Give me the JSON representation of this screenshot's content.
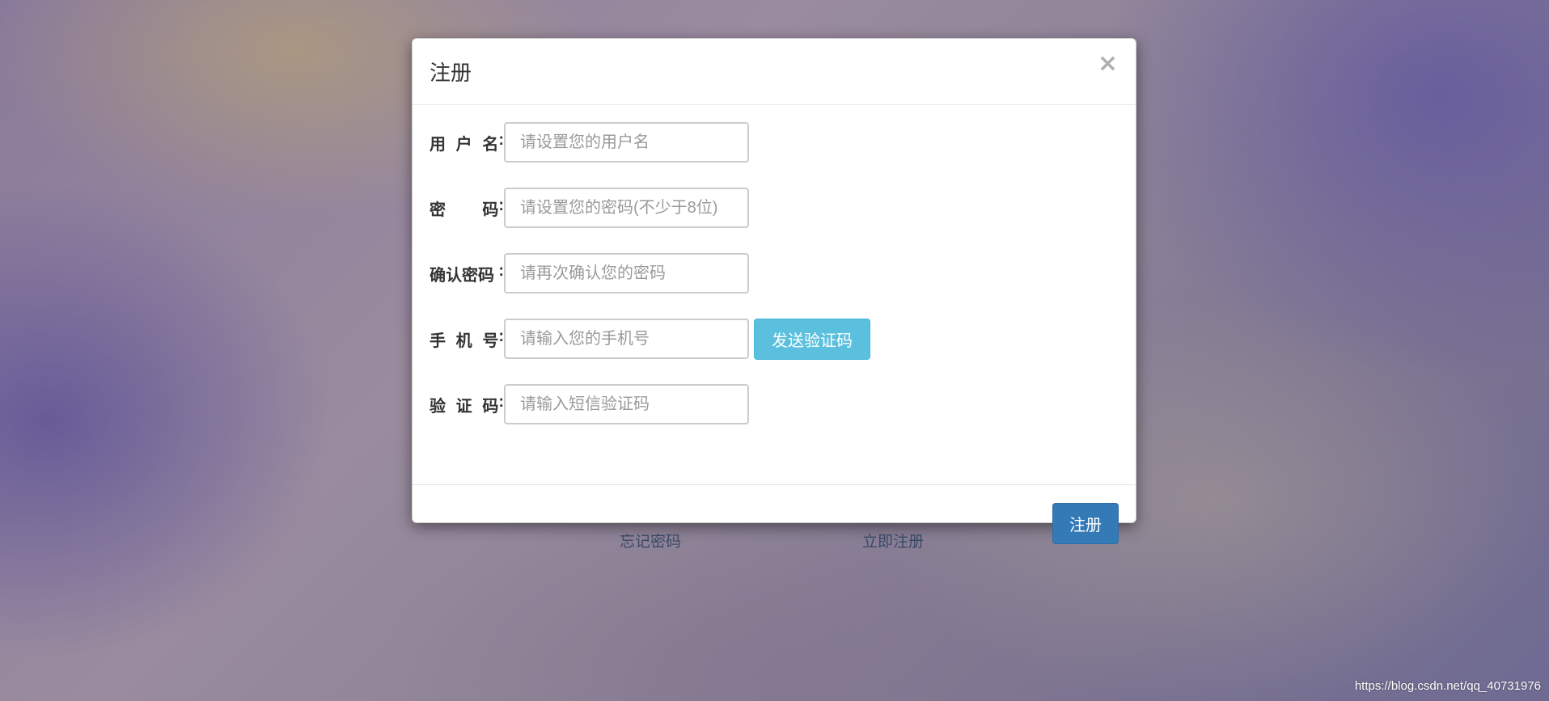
{
  "background": {
    "links": {
      "forgot_password": "忘记密码",
      "register_now": "立即注册"
    },
    "watermark": "https://blog.csdn.net/qq_40731976"
  },
  "modal": {
    "title": "注册",
    "close_symbol": "×",
    "fields": [
      {
        "label_chars": [
          "用",
          "户",
          "名"
        ],
        "colon": ":",
        "placeholder": "请设置您的用户名"
      },
      {
        "label_chars": [
          "密",
          "码"
        ],
        "colon": ":",
        "placeholder": "请设置您的密码(不少于8位)"
      },
      {
        "label_chars": [
          "确认密码"
        ],
        "colon": ":",
        "placeholder": "请再次确认您的密码"
      },
      {
        "label_chars": [
          "手",
          "机",
          "号"
        ],
        "colon": ":",
        "placeholder": "请输入您的手机号"
      },
      {
        "label_chars": [
          "验",
          "证",
          "码"
        ],
        "colon": ":",
        "placeholder": "请输入短信验证码"
      }
    ],
    "send_code_button": "发送验证码",
    "submit_button": "注册"
  },
  "colors": {
    "primary": "#337ab7",
    "info": "#5bc0de"
  }
}
